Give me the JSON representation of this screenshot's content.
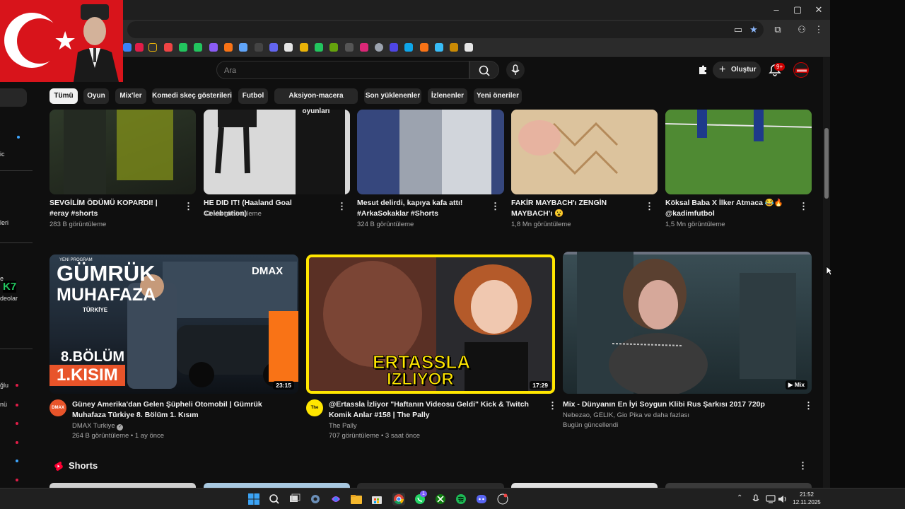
{
  "window": {
    "minimize": "–",
    "maximize": "▢",
    "close": "✕"
  },
  "header": {
    "search_placeholder": "Ara",
    "create_label": "Oluştur",
    "notifications_badge": "9+"
  },
  "chips": [
    "Tümü",
    "Oyun",
    "Mix'ler",
    "Komedi skeç gösterileri",
    "Futbol",
    "Aksiyon-macera oyunları",
    "Son yüklenenler",
    "İzlenenler",
    "Yeni öneriler"
  ],
  "sidebar": {
    "fragments": [
      "ic",
      "leri",
      "e",
      "K7",
      "deolar",
      "ğlu",
      "nü"
    ]
  },
  "shorts_row": [
    {
      "title": "SEVGİLİM ÖDÜMÜ KOPARDI! | #eray #shorts",
      "views": "283 B görüntüleme"
    },
    {
      "title": "HE DID IT! (Haaland Goal Celebration)",
      "views": "41 Mn görüntüleme"
    },
    {
      "title": "Mesut delirdi, kapıya kafa attı! #ArkaSokaklar #Shorts",
      "views": "324 B görüntüleme"
    },
    {
      "title": "FAKİR MAYBACH'ı ZENGİN MAYBACH'ı 😮",
      "views": "1,8 Mn görüntüleme"
    },
    {
      "title": "Köksal Baba X İlker Atmaca 😂🔥 @kadimfutbol",
      "views": "1,5 Mn görüntüleme"
    }
  ],
  "videos": [
    {
      "title": "Güney Amerika'dan Gelen Şüpheli Otomobil | Gümrük Muhafaza Türkiye 8. Bölüm 1. Kısım",
      "channel": "DMAX Turkiye",
      "verified": "✓",
      "meta": "264 B görüntüleme • 1 ay önce",
      "duration": "23:15",
      "avatar_text": "DMAX",
      "thumb": {
        "badge": "YENİ PROGRAM",
        "logo": "DMAX",
        "line1": "GÜMRÜK",
        "line2": "MUHAFAZA",
        "country": "TÜRKİYE",
        "episode": "8.BÖLÜM",
        "part": "1.KISIM"
      }
    },
    {
      "title": "@Ertassla İzliyor \"Haftanın Videosu Geldi\" Kick & Twitch Komik Anlar #158 | The Pally",
      "channel": "The Pally",
      "meta": "707 görüntüleme • 3 saat önce",
      "duration": "17:29",
      "avatar_text": "The Pally",
      "thumb": {
        "line1": "ERTASSLA",
        "line2": "IZLIYOR"
      }
    },
    {
      "title": "Mix - Dünyanın En İyi Soygun Klibi Rus Şarkısı 2017 720p",
      "channel": "Nebezao, GELIK, Gio Pika ve daha fazlası",
      "meta": "Bugün güncellendi",
      "duration": "▶ Mix"
    }
  ],
  "shorts_section_title": "Shorts",
  "taskbar": {
    "time": "21:52",
    "date": "12.11.2025",
    "whatsapp_badge": "1"
  },
  "colors": {
    "youtube_red": "#ff0000",
    "accent_yellow": "#ffe600",
    "background": "#0f0f0f"
  }
}
